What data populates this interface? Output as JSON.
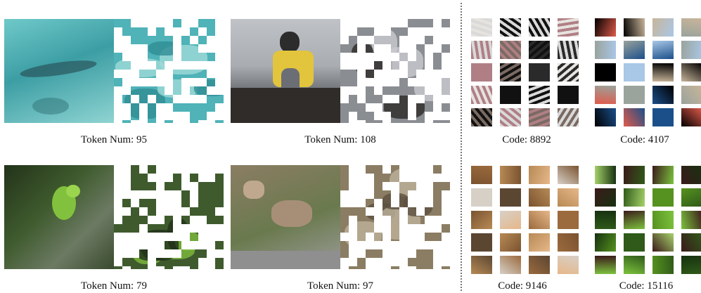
{
  "left_panels": [
    {
      "caption": "Token Num: 95",
      "colors": {
        "base": "#4fb3b8",
        "dark": "#2f8c93",
        "light": "#9fd9d8"
      }
    },
    {
      "caption": "Token Num: 108",
      "colors": {
        "base": "#7b7f86",
        "dark": "#2d2a28",
        "light": "#c8cbcf"
      }
    },
    {
      "caption": "Token Num: 79",
      "colors": {
        "base": "#3f5b2e",
        "dark": "#22311a",
        "light": "#7ebb3c"
      }
    },
    {
      "caption": "Token Num: 97",
      "colors": {
        "base": "#8b7d63",
        "dark": "#5c5040",
        "light": "#bdb29b"
      }
    }
  ],
  "codebooks": [
    {
      "caption": "Code: 8892",
      "palette": [
        "#2a2a2a",
        "#d9d9d9",
        "#7a6a62",
        "#b07f86",
        "#111111",
        "#e7e3df"
      ]
    },
    {
      "caption": "Code: 4107",
      "palette": [
        "#e15a4a",
        "#c8b59a",
        "#1b4f8a",
        "#a9c7e6",
        "#000000",
        "#9aa39c"
      ]
    },
    {
      "caption": "Code: 9146",
      "palette": [
        "#b78a55",
        "#5b4632",
        "#e6b789",
        "#9b6a3d",
        "#d7d0c7",
        "#7a5330"
      ]
    },
    {
      "caption": "Code: 15116",
      "palette": [
        "#2f5a19",
        "#7cc23e",
        "#163110",
        "#56921f",
        "#a6d26a",
        "#3b1a1a"
      ]
    }
  ]
}
